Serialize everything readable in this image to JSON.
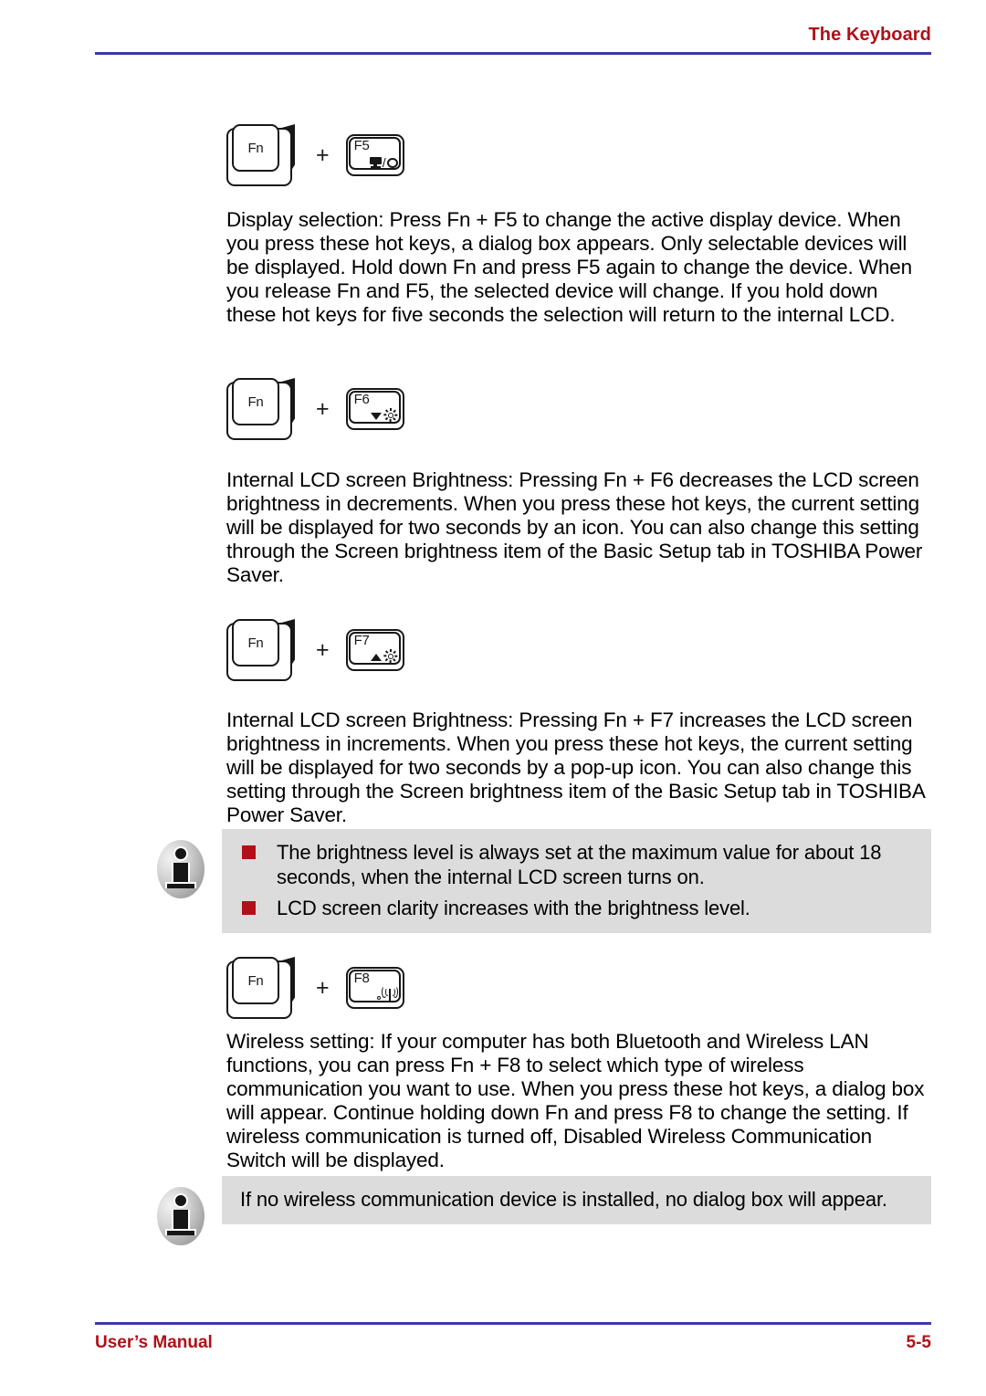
{
  "header": {
    "title": "The Keyboard",
    "rule_color": "#3b38a8",
    "title_color": "#b01018"
  },
  "footer": {
    "left": "User’s Manual",
    "right": "5-5",
    "rule_color": "#3b38a8",
    "text_color": "#b01018"
  },
  "theme": {
    "note_background": "#dcdcdc",
    "bullet_color": "#b01018",
    "key_outline": "#171717"
  },
  "key_combos": [
    {
      "modifier_label": "Fn",
      "separator": "+",
      "function_label": "F5",
      "glyph": "display-switch-icon"
    },
    {
      "modifier_label": "Fn",
      "separator": "+",
      "function_label": "F6",
      "glyph": "brightness-down-icon"
    },
    {
      "modifier_label": "Fn",
      "separator": "+",
      "function_label": "F7",
      "glyph": "brightness-up-icon"
    },
    {
      "modifier_label": "Fn",
      "separator": "+",
      "function_label": "F8",
      "glyph": "wireless-antenna-icon"
    }
  ],
  "paragraphs": [
    {
      "id": "display-selection",
      "text": "Display selection:   Press Fn + F5 to change the active display device. When you press these hot keys, a dialog box appears. Only selectable devices will be displayed. Hold down Fn and press F5 again to change the device. When you release Fn and F5, the selected device will change. If you hold down these hot keys for five seconds the selection will return to the internal LCD."
    },
    {
      "id": "brightness-decrease",
      "text": "Internal LCD screen Brightness:    Pressing Fn + F6 decreases the LCD screen brightness in decrements. When you press these hot keys, the current setting will be displayed for two seconds by an icon. You can also change this setting through the Screen brightness item of the Basic Setup tab in TOSHIBA Power Saver."
    },
    {
      "id": "brightness-increase",
      "text": "Internal LCD screen Brightness:    Pressing Fn + F7 increases the LCD screen brightness in increments. When you press these hot keys, the current setting will be displayed for two seconds by a pop-up icon. You can also change this setting through the Screen brightness item of the Basic Setup tab in TOSHIBA Power Saver."
    },
    {
      "id": "wireless-setting",
      "text": "Wireless setting:   If your computer has both Bluetooth and Wireless LAN functions, you can press Fn + F8 to select which type of wireless communication you want to use. When you press these hot keys, a dialog box will appear. Continue holding down Fn and press F8 to change the setting. If wireless communication is turned off, Disabled Wireless Communication Switch      will be displayed."
    }
  ],
  "notes": [
    {
      "id": "brightness-note",
      "icon": "info-icon",
      "bullets": [
        "The brightness level is always set at the maximum value for about 18 seconds, when the internal LCD screen turns on.",
        "LCD screen clarity increases with the brightness level."
      ]
    },
    {
      "id": "wireless-note",
      "icon": "info-icon",
      "text": "If no wireless communication device is installed, no dialog box will appear."
    }
  ]
}
